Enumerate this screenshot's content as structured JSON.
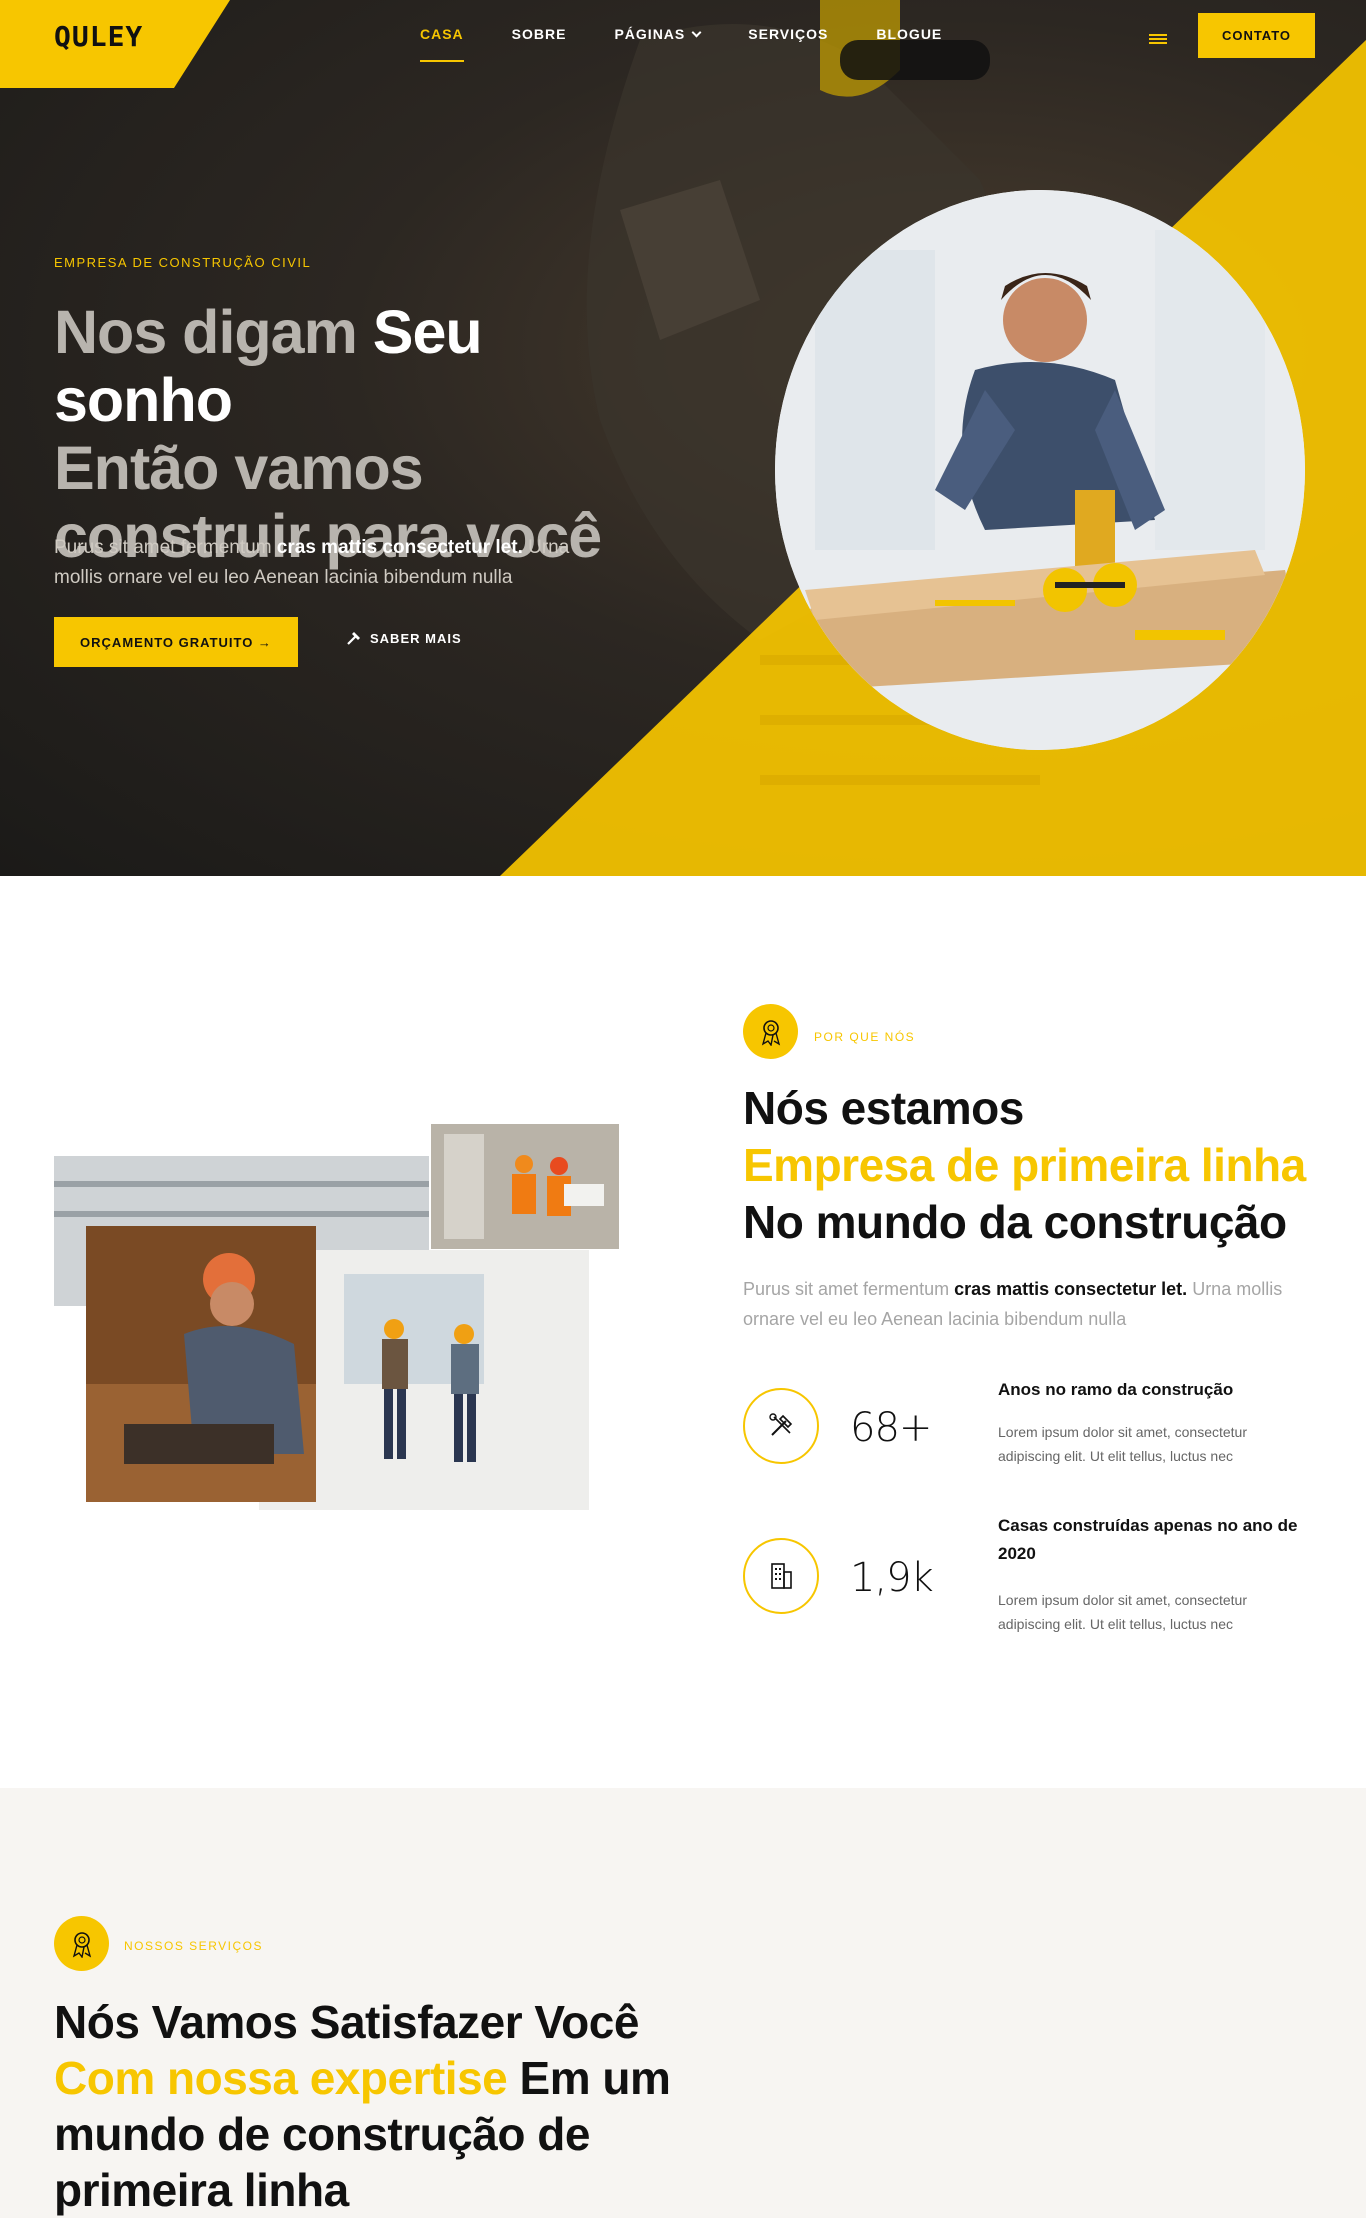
{
  "header": {
    "logo": "QULEY",
    "nav": [
      {
        "label": "CASA",
        "active": true
      },
      {
        "label": "SOBRE"
      },
      {
        "label": "PÁGINAS",
        "dropdown": true
      },
      {
        "label": "SERVIÇOS"
      },
      {
        "label": "BLOGUE"
      }
    ],
    "contact_label": "CONTATO"
  },
  "hero": {
    "eyebrow": "EMPRESA DE CONSTRUÇÃO CIVIL",
    "title_part1": "Nos digam ",
    "title_highlight": "Seu sonho",
    "title_part2": "Então vamos construir para você",
    "text_part1": "Purus sit amet fermentum ",
    "text_bold": "cras mattis consectetur let.",
    "text_part2": " Urna mollis ornare vel eu leo Aenean lacinia bibendum nulla",
    "cta_primary": "ORÇAMENTO GRATUITO →",
    "cta_secondary": "SABER MAIS"
  },
  "about": {
    "eyebrow": "POR QUE NÓS",
    "title_line1": "Nós estamos",
    "title_highlight": "Empresa de primeira linha",
    "title_line3": "No mundo da construção",
    "text_part1": "Purus sit amet fermentum ",
    "text_bold": "cras mattis consectetur let.",
    "text_part2": " Urna mollis ornare vel eu leo Aenean lacinia bibendum nulla",
    "stats": [
      {
        "icon": "tools-icon",
        "value": "68+",
        "label": "Anos no ramo da construção",
        "desc": "Lorem ipsum dolor sit amet, consectetur adipiscing elit. Ut elit tellus, luctus nec"
      },
      {
        "icon": "building-icon",
        "value": "1,9k",
        "label": "Casas construídas apenas no ano de 2020",
        "desc": "Lorem ipsum dolor sit amet, consectetur adipiscing elit. Ut elit tellus, luctus nec"
      }
    ]
  },
  "services": {
    "eyebrow": "NOSSOS SERVIÇOS",
    "title_part1": "Nós Vamos Satisfazer Você",
    "title_highlight": "Com nossa expertise",
    "title_part2": " Em um mundo de construção de primeira linha"
  },
  "colors": {
    "accent": "#f7c600",
    "dark": "#1b1a18",
    "services_bg": "#f7f5f2"
  }
}
